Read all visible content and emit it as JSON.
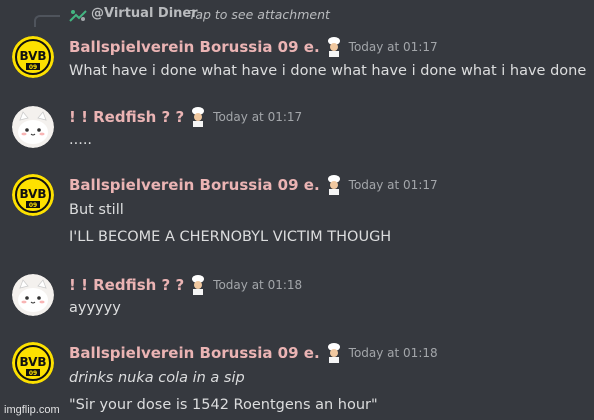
{
  "reply": {
    "author": "@Virtual Diner",
    "preview": "Tap to see attachment"
  },
  "messages": [
    {
      "author": "Ballspielverein Borussia 09 e.",
      "avatar": "bvb-logo",
      "timestamp": "Today at 01:17",
      "lines": [
        "What have i done what have i done what have i done what i have done"
      ]
    },
    {
      "author": "! ! Redfish ? ?",
      "avatar": "cat-avatar",
      "timestamp": "Today at 01:17",
      "lines": [
        "....."
      ]
    },
    {
      "author": "Ballspielverein Borussia 09 e.",
      "avatar": "bvb-logo",
      "timestamp": "Today at 01:17",
      "lines": [
        "But still",
        "I'LL BECOME A CHERNOBYL VICTIM THOUGH"
      ]
    },
    {
      "author": "! ! Redfish ? ?",
      "avatar": "cat-avatar",
      "timestamp": "Today at 01:18",
      "lines": [
        "ayyyyy"
      ]
    },
    {
      "author": "Ballspielverein Borussia 09 e.",
      "avatar": "bvb-logo",
      "timestamp": "Today at 01:18",
      "lines": [
        "drinks nuka cola in a sip",
        "\"Sir your dose is 1542 Roentgens an hour\""
      ]
    }
  ],
  "watermark": "imgflip.com",
  "colors": {
    "background": "#36393f",
    "author": "#ebb4b4",
    "text": "#dcddde",
    "timestamp": "#a3a6aa",
    "bvb_yellow": "#fde100"
  }
}
